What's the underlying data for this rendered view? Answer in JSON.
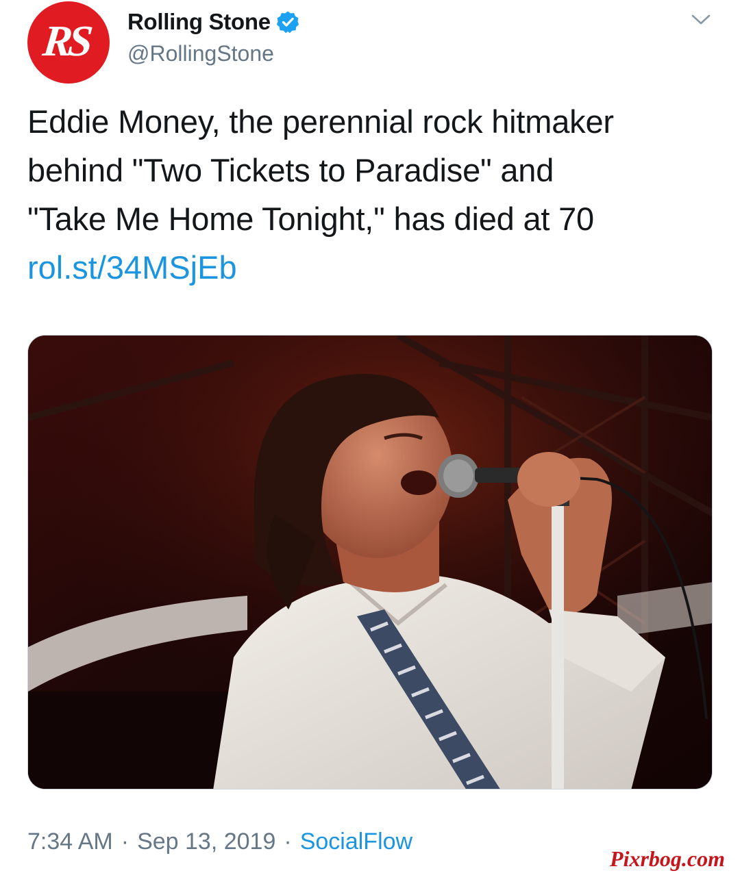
{
  "account": {
    "display_name": "Rolling Stone",
    "handle": "@RollingStone",
    "avatar_text": "RS",
    "verified": true
  },
  "tweet": {
    "text_lines": [
      "Eddie Money, the perennial rock hitmaker",
      "behind \"Two Tickets to Paradise\" and",
      "\"Take Me Home Tonight,\" has died at 70"
    ],
    "link": "rol.st/34MSjEb"
  },
  "meta": {
    "time": "7:34 AM",
    "separator": "·",
    "date": "Sep 13, 2019",
    "source": "SocialFlow"
  },
  "watermark": "Pixrbog.com",
  "icons": {
    "verified": "verified-badge-icon",
    "menu": "chevron-down-icon"
  },
  "colors": {
    "text": "#14171a",
    "secondary": "#657786",
    "link": "#1b95e0",
    "verified": "#1da1f2",
    "avatar": "#e01b22",
    "watermark": "#c4161c"
  }
}
